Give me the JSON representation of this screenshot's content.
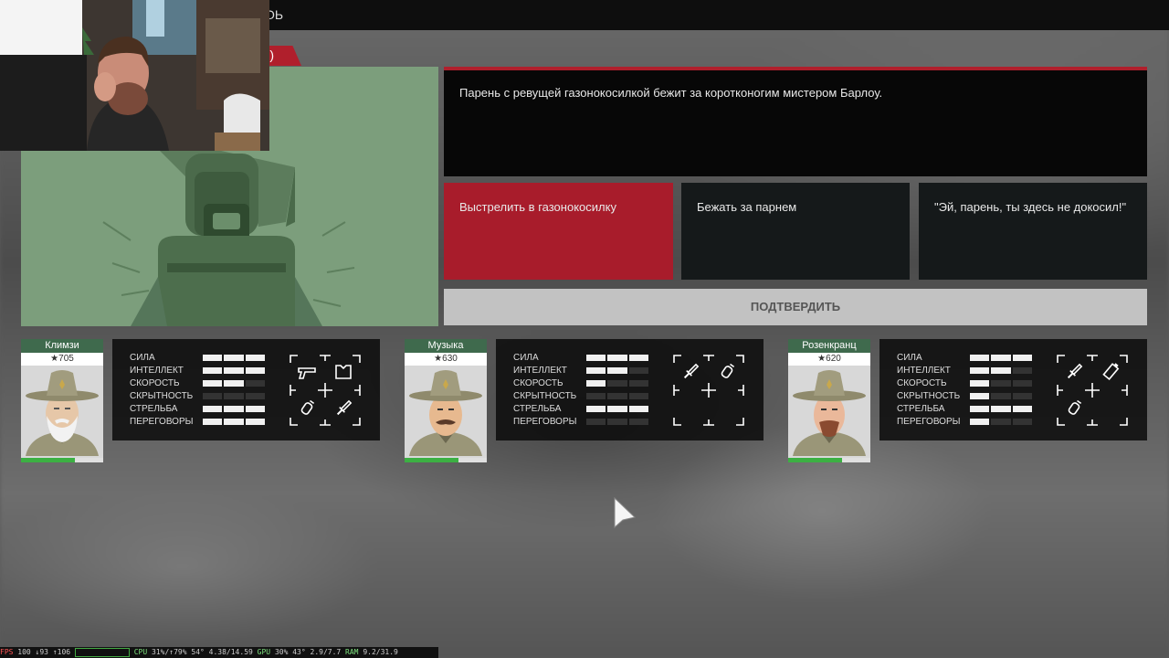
{
  "header": {
    "title_fragment": "ОЬ",
    "red_tab_fragment": ")"
  },
  "narration": "Парень с ревущей газонокосилкой бежит за коротконогим мистером Барлоу.",
  "choices": [
    {
      "label": "Выстрелить в газонокосилку",
      "selected": true
    },
    {
      "label": "Бежать за парнем",
      "selected": false
    },
    {
      "label": "\"Эй, парень, ты здесь не докосил!\"",
      "selected": false
    }
  ],
  "confirm_label": "ПОДТВЕРДИТЬ",
  "stat_labels": [
    "СИЛА",
    "ИНТЕЛЛЕКТ",
    "СКОРОСТЬ",
    "СКРЫТНОСТЬ",
    "СТРЕЛЬБА",
    "ПЕРЕГОВОРЫ"
  ],
  "rangers": [
    {
      "name": "Климзи",
      "xp": "705",
      "health": 0.66,
      "stats": [
        3,
        3,
        2,
        0,
        3,
        3
      ],
      "items": [
        "revolver-icon",
        "armor-icon",
        "grenade-icon",
        "knife-icon"
      ]
    },
    {
      "name": "Музыка",
      "xp": "630",
      "health": 0.66,
      "stats": [
        3,
        2,
        1,
        0,
        3,
        0
      ],
      "items": [
        "knife-icon",
        "grenade-icon"
      ]
    },
    {
      "name": "Розенкранц",
      "xp": "620",
      "health": 0.66,
      "stats": [
        3,
        2,
        1,
        1,
        3,
        1
      ],
      "items": [
        "knife-icon",
        "canister-icon",
        "grenade-icon"
      ]
    }
  ],
  "taskbar": {
    "fps": "FPS",
    "fps_value": "100 ↓93 ↑106",
    "cpu": "CPU",
    "cpu_value": "31%/↑79%",
    "cpu_temp": "54°",
    "cpu_clock": "4.38/14.59",
    "gpu": "GPU",
    "gpu_value": "30%",
    "gpu_temp": "43°",
    "gpu_mem": "2.9/7.7",
    "ram": "RAM",
    "ram_value": "9.2/31.9"
  },
  "colors": {
    "accent_red": "#b01f2c",
    "ranger_green": "#3f6a4d",
    "health_green": "#3cb043"
  }
}
